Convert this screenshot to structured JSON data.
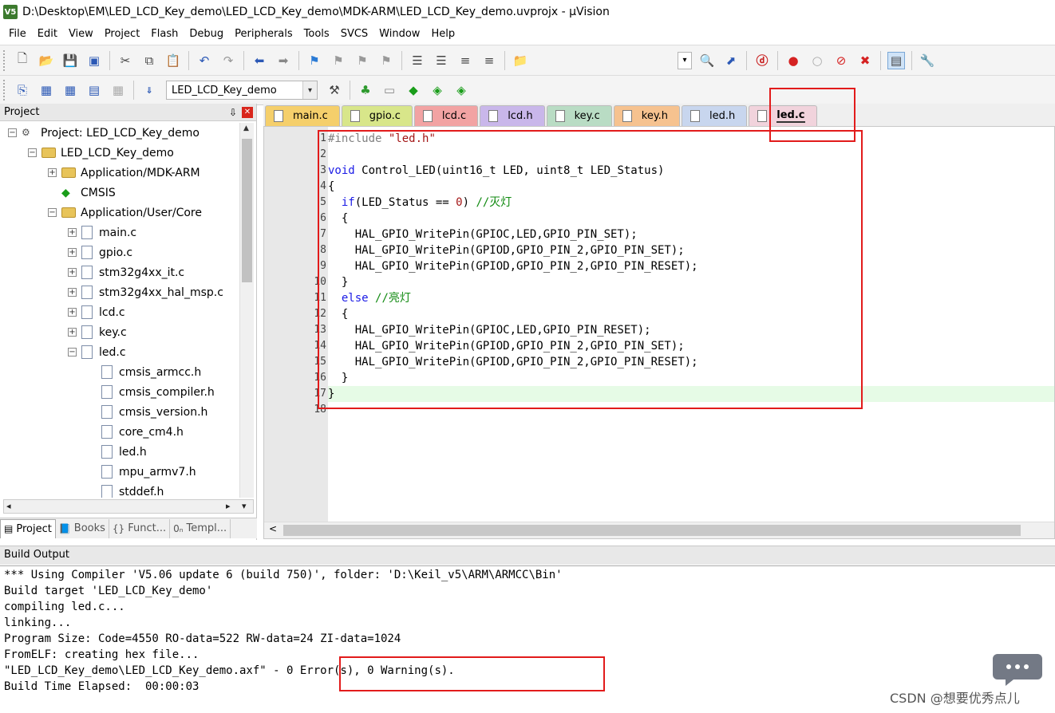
{
  "window": {
    "title": "D:\\Desktop\\EM\\LED_LCD_Key_demo\\LED_LCD_Key_demo\\MDK-ARM\\LED_LCD_Key_demo.uvprojx - µVision",
    "logo": "V5"
  },
  "menu": [
    "File",
    "Edit",
    "View",
    "Project",
    "Flash",
    "Debug",
    "Peripherals",
    "Tools",
    "SVCS",
    "Window",
    "Help"
  ],
  "toolbar2": {
    "target": "LED_LCD_Key_demo"
  },
  "project_panel": {
    "title": "Project",
    "tree": [
      {
        "label": "Project: LED_LCD_Key_demo",
        "level": 0,
        "toggle": "−",
        "icon": "project-icon"
      },
      {
        "label": "LED_LCD_Key_demo",
        "level": 1,
        "toggle": "−",
        "icon": "folder-icon"
      },
      {
        "label": "Application/MDK-ARM",
        "level": 2,
        "toggle": "+",
        "icon": "folder-icon"
      },
      {
        "label": "CMSIS",
        "level": 2,
        "toggle": "",
        "icon": "cmsis-gem-icon"
      },
      {
        "label": "Application/User/Core",
        "level": 2,
        "toggle": "−",
        "icon": "folder-icon"
      },
      {
        "label": "main.c",
        "level": 3,
        "toggle": "+",
        "icon": "file-icon"
      },
      {
        "label": "gpio.c",
        "level": 3,
        "toggle": "+",
        "icon": "file-icon"
      },
      {
        "label": "stm32g4xx_it.c",
        "level": 3,
        "toggle": "+",
        "icon": "file-icon"
      },
      {
        "label": "stm32g4xx_hal_msp.c",
        "level": 3,
        "toggle": "+",
        "icon": "file-icon"
      },
      {
        "label": "lcd.c",
        "level": 3,
        "toggle": "+",
        "icon": "file-icon"
      },
      {
        "label": "key.c",
        "level": 3,
        "toggle": "+",
        "icon": "file-icon"
      },
      {
        "label": "led.c",
        "level": 3,
        "toggle": "−",
        "icon": "file-icon"
      },
      {
        "label": "cmsis_armcc.h",
        "level": 4,
        "toggle": "",
        "icon": "file-icon"
      },
      {
        "label": "cmsis_compiler.h",
        "level": 4,
        "toggle": "",
        "icon": "file-icon"
      },
      {
        "label": "cmsis_version.h",
        "level": 4,
        "toggle": "",
        "icon": "file-icon"
      },
      {
        "label": "core_cm4.h",
        "level": 4,
        "toggle": "",
        "icon": "file-icon"
      },
      {
        "label": "led.h",
        "level": 4,
        "toggle": "",
        "icon": "file-icon"
      },
      {
        "label": "mpu_armv7.h",
        "level": 4,
        "toggle": "",
        "icon": "file-icon"
      },
      {
        "label": "stddef.h",
        "level": 4,
        "toggle": "",
        "icon": "file-icon"
      }
    ],
    "tabs": [
      {
        "label": "Project",
        "icon": "project-tab-icon",
        "active": true
      },
      {
        "label": "Books",
        "icon": "books-icon",
        "active": false
      },
      {
        "label": "Funct...",
        "icon": "braces-icon",
        "active": false
      },
      {
        "label": "Templ...",
        "icon": "template-icon",
        "active": false
      }
    ]
  },
  "editor_tabs": [
    {
      "label": "main.c",
      "color": "#f5cf6b",
      "active": false
    },
    {
      "label": "gpio.c",
      "color": "#d8e68a",
      "active": false
    },
    {
      "label": "lcd.c",
      "color": "#f2a3a3",
      "active": false
    },
    {
      "label": "lcd.h",
      "color": "#c9b7ea",
      "active": false
    },
    {
      "label": "key.c",
      "color": "#b9dcc4",
      "active": false
    },
    {
      "label": "key.h",
      "color": "#f6c28f",
      "active": false
    },
    {
      "label": "led.h",
      "color": "#c8d6ee",
      "active": false
    },
    {
      "label": "led.c",
      "color": "#f1d3dc",
      "active": true
    }
  ],
  "code_lines": [
    "#include \"led.h\"",
    "",
    "void Control_LED(uint16_t LED, uint8_t LED_Status)",
    "{",
    "  if(LED_Status == 0) //灭灯",
    "  {",
    "    HAL_GPIO_WritePin(GPIOC,LED,GPIO_PIN_SET);",
    "    HAL_GPIO_WritePin(GPIOD,GPIO_PIN_2,GPIO_PIN_SET);",
    "    HAL_GPIO_WritePin(GPIOD,GPIO_PIN_2,GPIO_PIN_RESET);",
    "  }",
    "  else //亮灯",
    "  {",
    "    HAL_GPIO_WritePin(GPIOC,LED,GPIO_PIN_RESET);",
    "    HAL_GPIO_WritePin(GPIOD,GPIO_PIN_2,GPIO_PIN_SET);",
    "    HAL_GPIO_WritePin(GPIOD,GPIO_PIN_2,GPIO_PIN_RESET);",
    "  }",
    "}",
    ""
  ],
  "build": {
    "title": "Build Output",
    "lines": [
      "*** Using Compiler 'V5.06 update 6 (build 750)', folder: 'D:\\Keil_v5\\ARM\\ARMCC\\Bin'",
      "Build target 'LED_LCD_Key_demo'",
      "compiling led.c...",
      "linking...",
      "Program Size: Code=4550 RO-data=522 RW-data=24 ZI-data=1024",
      "FromELF: creating hex file...",
      "\"LED_LCD_Key_demo\\LED_LCD_Key_demo.axf\" - 0 Error(s), 0 Warning(s).",
      "Build Time Elapsed:  00:00:03"
    ]
  },
  "watermark": "CSDN @想要优秀点儿",
  "colors": {
    "annotation": "#e21b1b",
    "current_line": "#e6fbe6"
  }
}
